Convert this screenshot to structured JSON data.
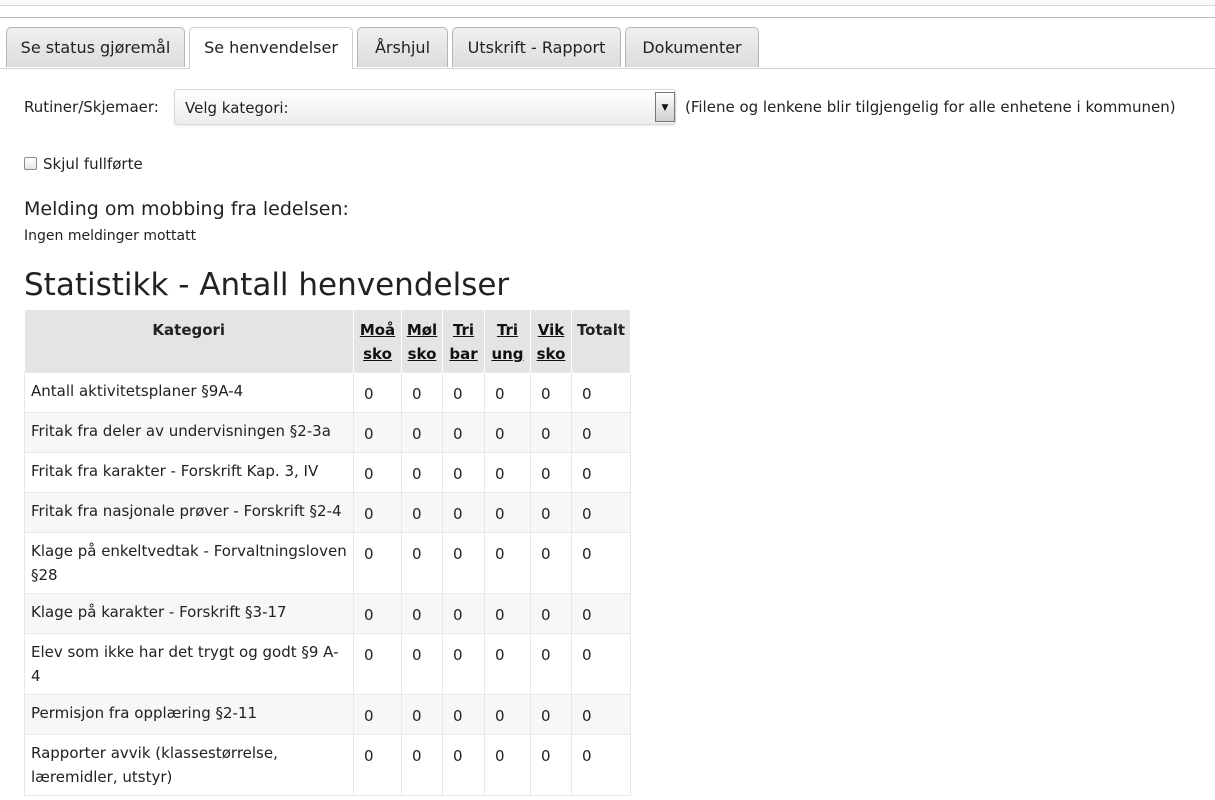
{
  "tabs": [
    {
      "label": "Se status gjøremål",
      "active": false
    },
    {
      "label": "Se henvendelser",
      "active": true
    },
    {
      "label": "Årshjul",
      "active": false
    },
    {
      "label": "Utskrift - Rapport",
      "active": false
    },
    {
      "label": "Dokumenter",
      "active": false
    }
  ],
  "filter": {
    "label": "Rutiner/Skjemaer:",
    "selected": "Velg kategori:",
    "note": "(Filene og lenkene blir tilgjengelig for alle enhetene i kommunen)"
  },
  "checkbox": {
    "label": "Skjul fullførte",
    "checked": false
  },
  "mobbing": {
    "title": "Melding om mobbing fra ledelsen:",
    "text": "Ingen meldinger mottatt"
  },
  "stats": {
    "title": "Statistikk - Antall henvendelser",
    "columns": {
      "category": "Kategori",
      "units": [
        {
          "line1": "Moå",
          "line2": "sko"
        },
        {
          "line1": "Møl",
          "line2": "sko"
        },
        {
          "line1": "Tri",
          "line2": "bar"
        },
        {
          "line1": "Tri",
          "line2": "ung"
        },
        {
          "line1": "Vik",
          "line2": "sko"
        }
      ],
      "total": "Totalt"
    },
    "rows": [
      {
        "category": "Antall aktivitetsplaner §9A-4",
        "values": [
          "0",
          "0",
          "0",
          "0",
          "0",
          "0"
        ]
      },
      {
        "category": "Fritak fra deler av undervisningen §2-3a",
        "values": [
          "0",
          "0",
          "0",
          "0",
          "0",
          "0"
        ]
      },
      {
        "category": "Fritak fra karakter - Forskrift Kap. 3, IV",
        "values": [
          "0",
          "0",
          "0",
          "0",
          "0",
          "0"
        ]
      },
      {
        "category": "Fritak fra nasjonale prøver - Forskrift §2-4",
        "values": [
          "0",
          "0",
          "0",
          "0",
          "0",
          "0"
        ]
      },
      {
        "category": "Klage på enkeltvedtak - Forvaltningsloven §28",
        "values": [
          "0",
          "0",
          "0",
          "0",
          "0",
          "0"
        ]
      },
      {
        "category": "Klage på karakter - Forskrift §3-17",
        "values": [
          "0",
          "0",
          "0",
          "0",
          "0",
          "0"
        ]
      },
      {
        "category": "Elev som ikke har det trygt og godt §9 A-4",
        "values": [
          "0",
          "0",
          "0",
          "0",
          "0",
          "0"
        ]
      },
      {
        "category": "Permisjon fra opplæring §2-11",
        "values": [
          "0",
          "0",
          "0",
          "0",
          "0",
          "0"
        ]
      },
      {
        "category": "Rapporter avvik (klassestørrelse, læremidler, utstyr)",
        "values": [
          "0",
          "0",
          "0",
          "0",
          "0",
          "0"
        ]
      }
    ]
  }
}
